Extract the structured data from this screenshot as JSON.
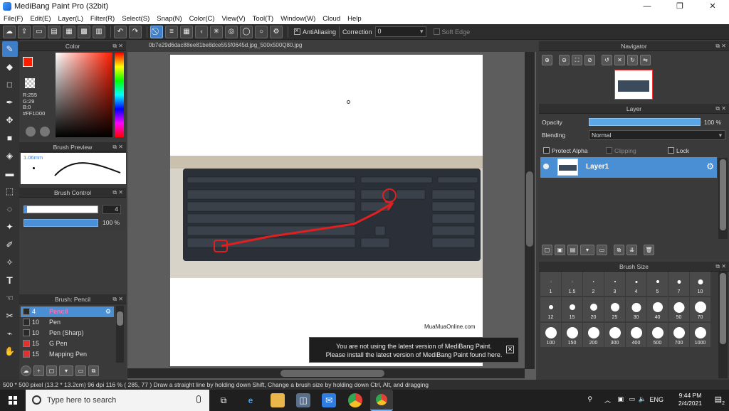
{
  "window": {
    "title": "MediBang Paint Pro (32bit)",
    "minimize": "—",
    "maximize": "❐",
    "close": "✕"
  },
  "menu": [
    "File(F)",
    "Edit(E)",
    "Layer(L)",
    "Filter(R)",
    "Select(S)",
    "Snap(N)",
    "Color(C)",
    "View(V)",
    "Tool(T)",
    "Window(W)",
    "Cloud",
    "Help"
  ],
  "toolbar": {
    "antialiasing_label": "AntiAliasing",
    "correction_label": "Correction",
    "correction_value": "0",
    "soft_edge_label": "Soft Edge"
  },
  "color_panel": {
    "title": "Color",
    "foreground": "#FF1D00",
    "rgb_lines": [
      "R:255",
      "G:29",
      "B:0",
      "#FF1D00"
    ]
  },
  "brush_preview": {
    "title": "Brush Preview",
    "size_label": "1.06mm"
  },
  "brush_control": {
    "title": "Brush Control",
    "size_value": "4",
    "opacity_value": "100 %",
    "opacity_fraction": 1.0
  },
  "brush_list": {
    "title": "Brush: Pencil",
    "items": [
      {
        "size": "4",
        "name": "Pencil",
        "color": "#2a2a2a",
        "selected": true
      },
      {
        "size": "10",
        "name": "Pen",
        "color": "#2a2a2a"
      },
      {
        "size": "10",
        "name": "Pen (Sharp)",
        "color": "#2a2a2a"
      },
      {
        "size": "15",
        "name": "G Pen",
        "color": "#e03030"
      },
      {
        "size": "15",
        "name": "Mapping Pen",
        "color": "#e03030"
      }
    ]
  },
  "document": {
    "tab_name": "0b7e29d6dac88ee81be8dce555f0645d.jpg_500x500Q80.jpg",
    "watermark": "MuaMuaOnline.com"
  },
  "notice": {
    "line1": "You are not using the latest version of MediBang Paint.",
    "line2": "Please install the latest version of MediBang Paint found here.",
    "close": "✕"
  },
  "navigator": {
    "title": "Navigator"
  },
  "layer_panel": {
    "title": "Layer",
    "opacity_label": "Opacity",
    "opacity_value": "100 %",
    "blending_label": "Blending",
    "blending_value": "Normal",
    "protect_alpha": "Protect Alpha",
    "clipping": "Clipping",
    "lock": "Lock",
    "layer_name": "Layer1"
  },
  "brush_size": {
    "title": "Brush Size",
    "sizes": [
      "1",
      "1.5",
      "2",
      "3",
      "4",
      "5",
      "7",
      "10",
      "12",
      "15",
      "20",
      "25",
      "30",
      "40",
      "50",
      "70",
      "100",
      "150",
      "200",
      "300",
      "400",
      "500",
      "700",
      "1000"
    ]
  },
  "status": {
    "text": "500 * 500 pixel   (13.2 * 13.2cm)   96 dpi   116 %   ( 285, 77 )   Draw a straight line by holding down Shift, Change a brush size by holding down Ctrl, Alt, and dragging"
  },
  "taskbar": {
    "search_placeholder": "Type here to search",
    "language": "ENG",
    "time": "9:44 PM",
    "date": "2/4/2021",
    "notification_count": "2"
  }
}
